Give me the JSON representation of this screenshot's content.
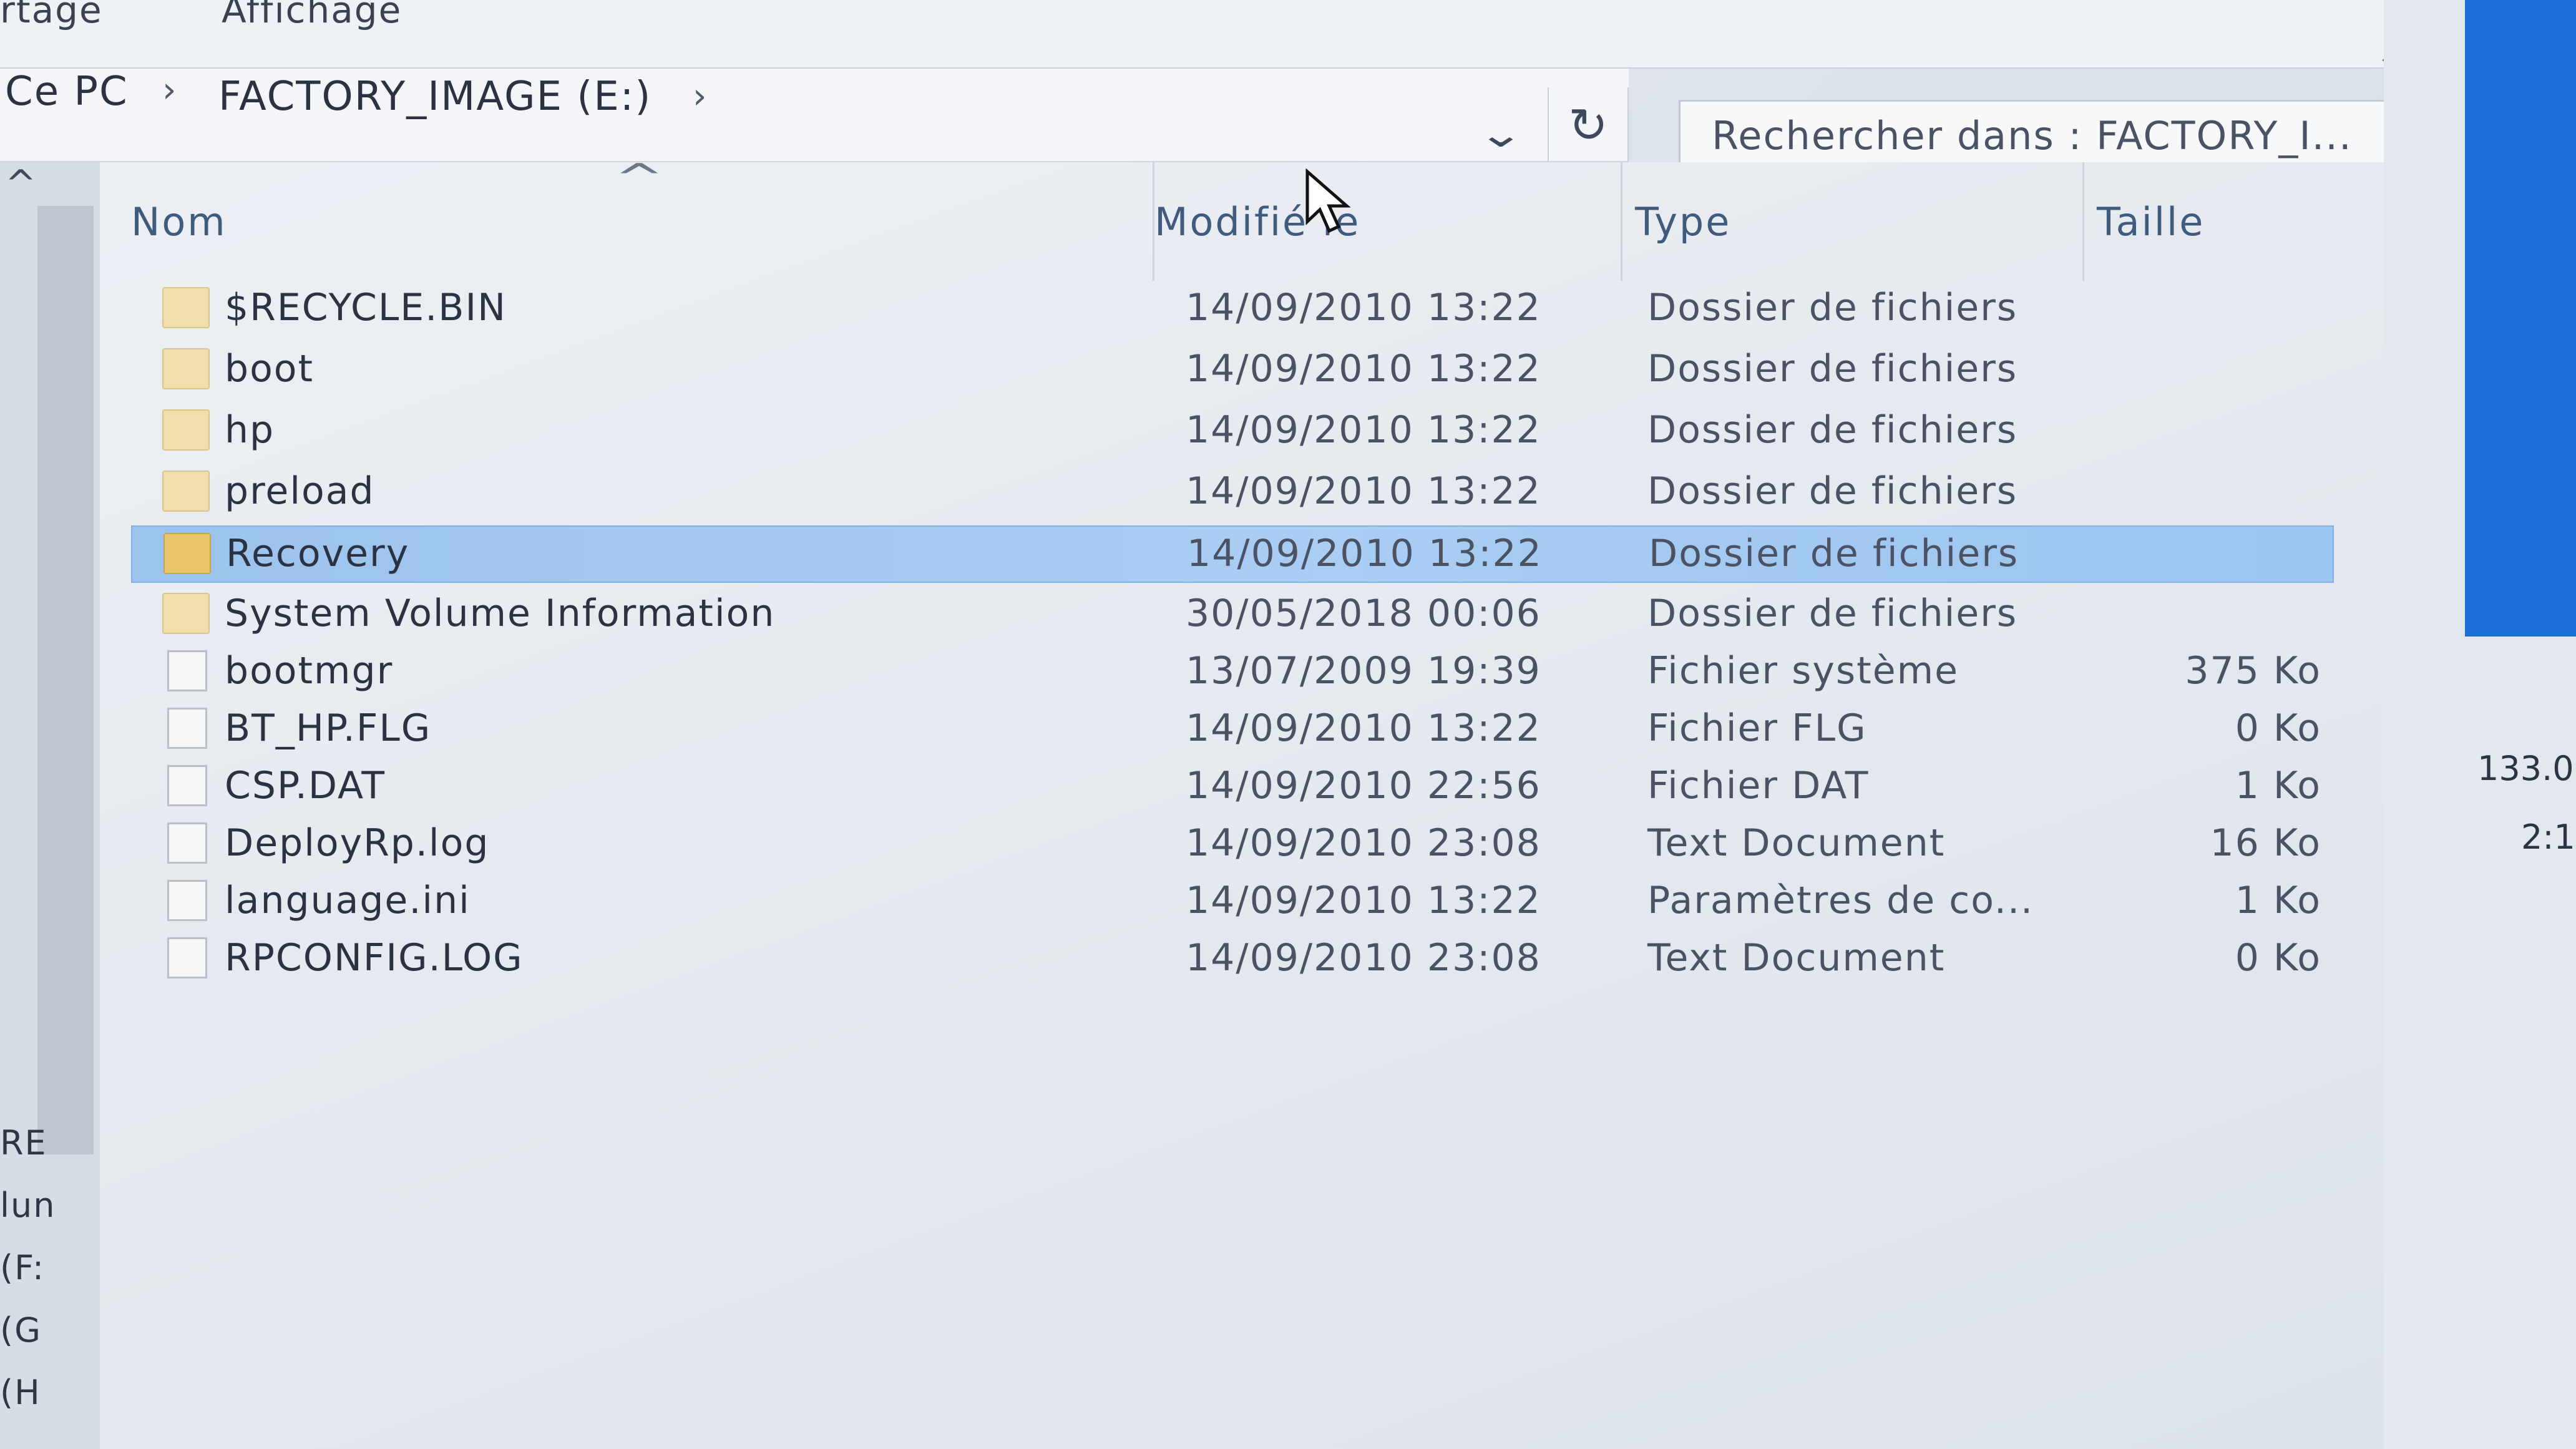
{
  "ribbon": {
    "tabs": [
      "rtage",
      "Affichage"
    ]
  },
  "address": {
    "crumbs": [
      "Ce PC",
      "FACTORY_IMAGE (E:)"
    ]
  },
  "search": {
    "placeholder": "Rechercher dans : FACTORY_I..."
  },
  "columns": {
    "name": "Nom",
    "modified": "Modifié le",
    "type": "Type",
    "size": "Taille"
  },
  "files": [
    {
      "name": "$RECYCLE.BIN",
      "modified": "14/09/2010 13:22",
      "type": "Dossier de fichiers",
      "size": "",
      "kind": "folder"
    },
    {
      "name": "boot",
      "modified": "14/09/2010 13:22",
      "type": "Dossier de fichiers",
      "size": "",
      "kind": "folder"
    },
    {
      "name": "hp",
      "modified": "14/09/2010 13:22",
      "type": "Dossier de fichiers",
      "size": "",
      "kind": "folder"
    },
    {
      "name": "preload",
      "modified": "14/09/2010 13:22",
      "type": "Dossier de fichiers",
      "size": "",
      "kind": "folder"
    },
    {
      "name": "Recovery",
      "modified": "14/09/2010 13:22",
      "type": "Dossier de fichiers",
      "size": "",
      "kind": "folder",
      "selected": true
    },
    {
      "name": "System Volume Information",
      "modified": "30/05/2018 00:06",
      "type": "Dossier de fichiers",
      "size": "",
      "kind": "folder"
    },
    {
      "name": "bootmgr",
      "modified": "13/07/2009 19:39",
      "type": "Fichier système",
      "size": "375 Ko",
      "kind": "file"
    },
    {
      "name": "BT_HP.FLG",
      "modified": "14/09/2010 13:22",
      "type": "Fichier FLG",
      "size": "0 Ko",
      "kind": "file"
    },
    {
      "name": "CSP.DAT",
      "modified": "14/09/2010 22:56",
      "type": "Fichier DAT",
      "size": "1 Ko",
      "kind": "file"
    },
    {
      "name": "DeployRp.log",
      "modified": "14/09/2010 23:08",
      "type": "Text Document",
      "size": "16 Ko",
      "kind": "file"
    },
    {
      "name": "language.ini",
      "modified": "14/09/2010 13:22",
      "type": "Paramètres de co...",
      "size": "1 Ko",
      "kind": "file"
    },
    {
      "name": "RPCONFIG.LOG",
      "modified": "14/09/2010 23:08",
      "type": "Text Document",
      "size": "0 Ko",
      "kind": "file"
    }
  ],
  "nav": {
    "items": [
      "RE",
      "lun",
      "(F:",
      "(G",
      "(H"
    ]
  },
  "right_window": {
    "values": [
      "133.0",
      "2:1"
    ]
  },
  "colors": {
    "selection": "#a9cdf3",
    "accent": "#1d6fd8",
    "folder": "#f1deaa"
  }
}
